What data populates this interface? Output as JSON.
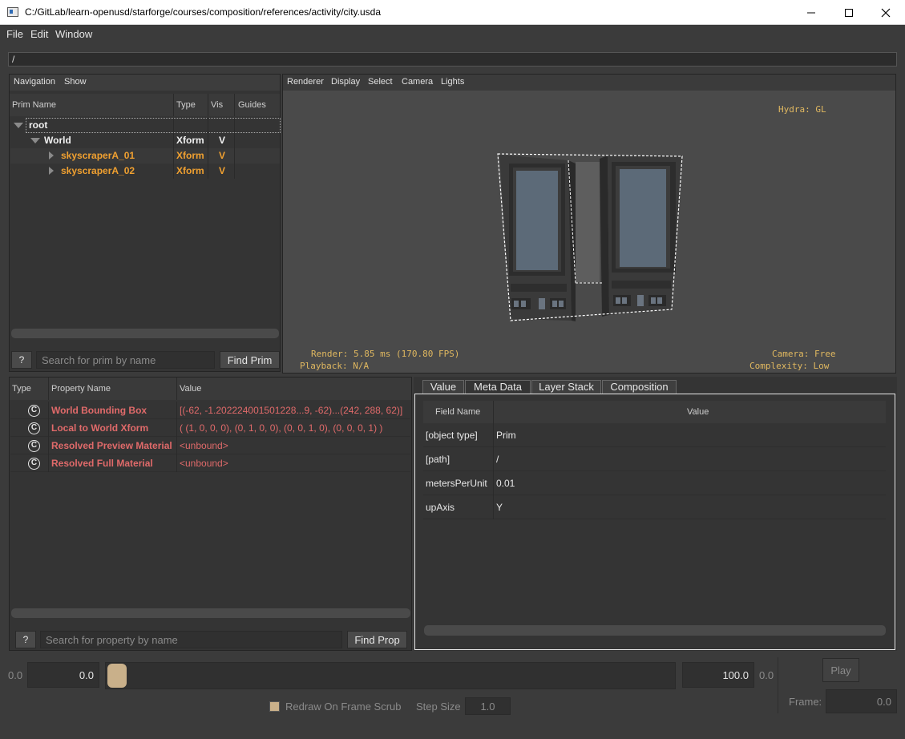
{
  "window": {
    "title": "C:/GitLab/learn-openusd/starforge/courses/composition/references/activity/city.usda",
    "minimize": "—",
    "maximize": "☐",
    "close": "✕"
  },
  "menu": [
    "File",
    "Edit",
    "Window"
  ],
  "path": "/",
  "navigation": {
    "toolbar": [
      "Navigation",
      "Show"
    ],
    "columns": [
      "Prim Name",
      "Type",
      "Vis",
      "Guides"
    ],
    "tree": [
      {
        "name": "root",
        "type": "",
        "vis": ""
      },
      {
        "name": "World",
        "type": "Xform",
        "vis": "V"
      },
      {
        "name": "skyscraperA_01",
        "type": "Xform",
        "vis": "V"
      },
      {
        "name": "skyscraperA_02",
        "type": "Xform",
        "vis": "V"
      }
    ],
    "help_label": "?",
    "search_placeholder": "Search for prim by name",
    "find_label": "Find Prim"
  },
  "viewport": {
    "toolbar": [
      "Renderer",
      "Display",
      "Select",
      "Camera",
      "Lights"
    ],
    "hud_renderer": "Hydra: GL",
    "hud_render": "Render: 5.85 ms (170.80 FPS)",
    "hud_playback": "Playback: N/A",
    "hud_camera": "Camera: Free",
    "hud_complexity": "Complexity: Low"
  },
  "properties": {
    "columns": [
      "Type",
      "Property Name",
      "Value"
    ],
    "rows": [
      {
        "icon": "C",
        "name": "World Bounding Box",
        "value": "[(-62, -1.202224001501228...9, -62)...(242, 288, 62)]"
      },
      {
        "icon": "C",
        "name": "Local to World Xform",
        "value": "( (1, 0, 0, 0), (0, 1, 0, 0), (0, 0, 1, 0), (0, 0, 0, 1) )"
      },
      {
        "icon": "C",
        "name": "Resolved Preview Material",
        "value": "<unbound>"
      },
      {
        "icon": "C",
        "name": "Resolved Full Material",
        "value": "<unbound>"
      }
    ],
    "help_label": "?",
    "search_placeholder": "Search for property by name",
    "find_label": "Find Prop"
  },
  "metadata": {
    "tabs": [
      "Value",
      "Meta Data",
      "Layer Stack",
      "Composition"
    ],
    "active_tab": "Meta Data",
    "columns": [
      "Field Name",
      "Value"
    ],
    "rows": [
      {
        "field": "[object type]",
        "value": "Prim"
      },
      {
        "field": "[path]",
        "value": "/"
      },
      {
        "field": "metersPerUnit",
        "value": "0.01"
      },
      {
        "field": "upAxis",
        "value": "Y"
      }
    ]
  },
  "timeline": {
    "start_label": "0.0",
    "start_value": "0.0",
    "end_value": "100.0",
    "end_label": "0.0",
    "play_label": "Play",
    "redraw_label": "Redraw On Frame Scrub",
    "step_label": "Step Size",
    "step_value": "1.0",
    "frame_label": "Frame:",
    "frame_value": "0.0"
  },
  "colors": {
    "prim_orange": "#f0a030",
    "prop_red": "#e06a6a",
    "hud_yellow": "#e0b860",
    "background": "#3b3b3b"
  }
}
